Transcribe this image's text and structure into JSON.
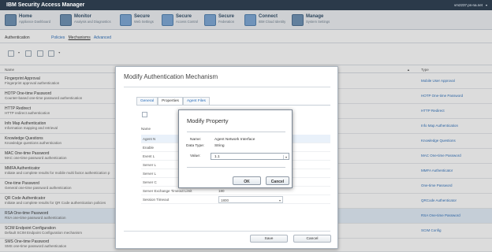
{
  "app": {
    "title": "IBM Security Access Manager",
    "user": "vm2237.ps-na.net"
  },
  "menu": [
    {
      "label": "Home",
      "sub": "Appliance Dashboard",
      "icon": "home-icon"
    },
    {
      "label": "Monitor",
      "sub": "Analysis and Diagnostics",
      "icon": "monitor-icon"
    },
    {
      "label": "Secure",
      "sub": "Web Settings",
      "icon": "web-settings-icon"
    },
    {
      "label": "Secure",
      "sub": "Access Control",
      "icon": "access-control-icon"
    },
    {
      "label": "Secure",
      "sub": "Federation",
      "icon": "federation-icon"
    },
    {
      "label": "Connect",
      "sub": "IBM Cloud Identity",
      "icon": "cloud-identity-icon"
    },
    {
      "label": "Manage",
      "sub": "System Settings",
      "icon": "system-settings-icon"
    }
  ],
  "page": {
    "section": "Authentication",
    "tabs": [
      "Policies",
      "Mechanisms",
      "Advanced"
    ],
    "columns": {
      "name": "Name",
      "type": "Type",
      "sort_icon": "sort-up-icon"
    },
    "rows": [
      {
        "title": "Fingerprint Approval",
        "desc": "Fingerprint approval authentication",
        "type": "Mobile User Approval"
      },
      {
        "title": "HOTP One-time Password",
        "desc": "Counter-based one-time password authentication",
        "type": "HOTP One-time Password"
      },
      {
        "title": "HTTP Redirect",
        "desc": "HTTP redirect authentication",
        "type": "HTTP Redirect"
      },
      {
        "title": "Info Map Authentication",
        "desc": "Information mapping and retrieval",
        "type": "Info Map Authentication"
      },
      {
        "title": "Knowledge Questions",
        "desc": "Knowledge questions authentication",
        "type": "Knowledge Questions"
      },
      {
        "title": "MAC One-time Password",
        "desc": "MAC one-time password authentication",
        "type": "MAC One-time Password"
      },
      {
        "title": "MMFA Authenticator",
        "desc": "Initiate and complete results for mobile multi factor authentication p",
        "type": "MMFA Authenticator"
      },
      {
        "title": "One-time Password",
        "desc": "General one-time password authentication",
        "type": "One-time Password"
      },
      {
        "title": "QR Code Authenticator",
        "desc": "Initiate and complete results for QR Code authentication policies",
        "type": "QRCode Authenticator"
      },
      {
        "title": "RSA One-time Password",
        "desc": "RSA one-time password authentication",
        "type": "RSA One-time Password"
      },
      {
        "title": "SCIM Endpoint Configuration",
        "desc": "Default SCIM Endpoint Configuration mechanism",
        "type": "SCIM Config"
      },
      {
        "title": "SMS One-time Password",
        "desc": "SMS one-time password authentication",
        "type": ""
      }
    ]
  },
  "modal": {
    "title": "Modify Authentication Mechanism",
    "tabs": [
      "General",
      "Properties",
      "Agent Files"
    ],
    "name_header": "Name",
    "properties": [
      {
        "name": "Agent N",
        "value": ""
      },
      {
        "name": "Enable",
        "value": ""
      },
      {
        "name": "Event L",
        "value": ""
      },
      {
        "name": "Server L",
        "value": ""
      },
      {
        "name": "Server L",
        "value": ""
      },
      {
        "name": "Server C",
        "value": ""
      },
      {
        "name": "Server Exchange Timeout Limit",
        "value": "180"
      },
      {
        "name": "Session Timeout",
        "value": "1800"
      }
    ],
    "save_label": "Save",
    "cancel_label": "Cancel"
  },
  "dialog": {
    "title": "Modify Property",
    "name_label": "Name:",
    "name_value": "Agent Network Interface",
    "datatype_label": "Data Type:",
    "datatype_value": "String",
    "value_label": "Value:",
    "value_current": "1.1",
    "ok_label": "OK",
    "cancel_label": "Cancel"
  },
  "colors": {
    "titlebar": "#2b3a4a",
    "link": "#2a6ebb",
    "selected_row": "#e3eef9"
  }
}
